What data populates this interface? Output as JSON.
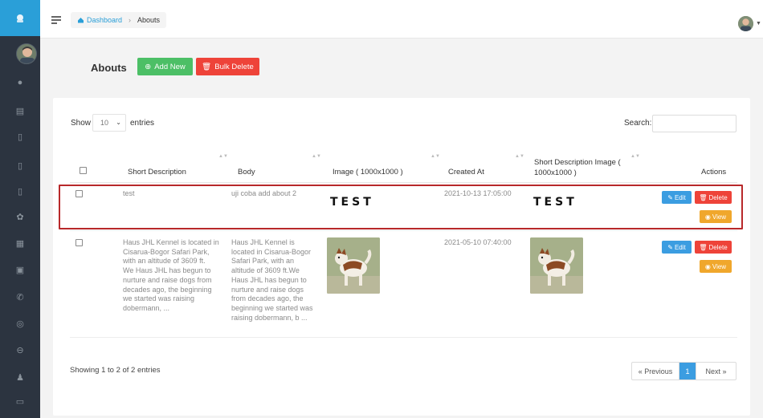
{
  "breadcrumb": {
    "home": "Dashboard",
    "current": "Abouts"
  },
  "page": {
    "title": "Abouts",
    "add_label": "Add New",
    "bulk_label": "Bulk Delete"
  },
  "controls": {
    "show_label": "Show",
    "entries_value": "10",
    "entries_label": "entries",
    "search_label": "Search:",
    "search_value": ""
  },
  "table": {
    "headers": {
      "short_description": "Short Description",
      "body": "Body",
      "image": "Image ( 1000x1000 )",
      "created_at": "Created At",
      "sd_image_line1": "Short Description Image (",
      "sd_image_line2": "1000x1000 )",
      "actions": "Actions"
    },
    "rows": [
      {
        "short_description": "test",
        "body": "uji coba add about 2",
        "image_text": "TEST",
        "created_at": "2021-10-13 17:05:00",
        "sd_image_text": "TEST"
      },
      {
        "short_description_lines": [
          "Haus JHL Kennel is located in",
          "Cisarua-Bogor Safari Park,",
          "with an altitude of 3609 ft.",
          "We Haus JHL has begun to",
          "nurture and raise dogs from",
          "decades ago, the beginning",
          "we started was raising",
          "dobermann, ..."
        ],
        "body_lines": [
          "Haus JHL Kennel is",
          "located in Cisarua-Bogor",
          "Safari Park, with an",
          "altitude of 3609 ft.We",
          "Haus JHL has begun to",
          "nurture and raise dogs",
          "from decades ago, the",
          "beginning we started was",
          "raising dobermann, b ..."
        ],
        "created_at": "2021-05-10 07:40:00"
      }
    ],
    "actions": {
      "edit": "Edit",
      "delete": "Delete",
      "view": "View"
    }
  },
  "footer": {
    "info": "Showing 1 to 2 of 2 entries",
    "prev": "« Previous",
    "page": "1",
    "next": "Next »"
  },
  "colors": {
    "brand": "#2a9fd8",
    "add": "#4cbf66",
    "delete": "#ee4339",
    "edit": "#3b9de1",
    "view": "#f0a72c",
    "highlight": "#b8282a"
  }
}
